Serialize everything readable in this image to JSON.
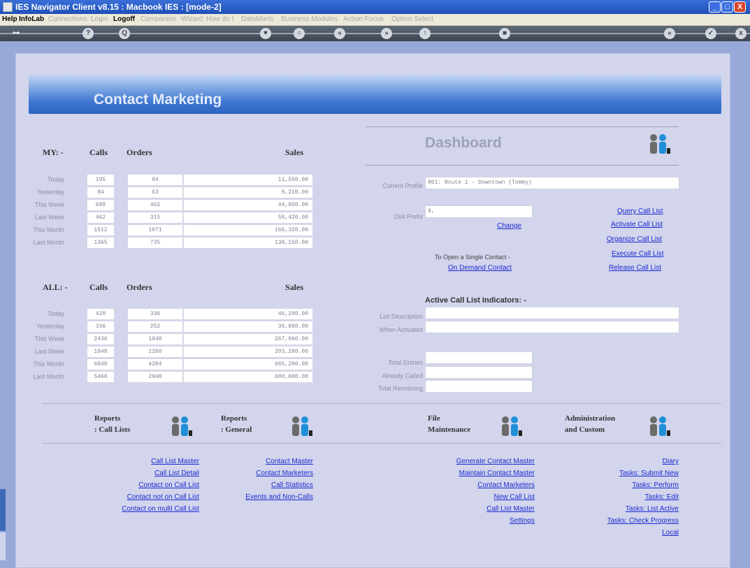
{
  "window": {
    "title": "IES Navigator Client v8.15 : Macbook IES :      [mode-2]",
    "min": "_",
    "max": "□",
    "close": "X"
  },
  "menu": {
    "items": [
      {
        "label": "Help",
        "enabled": true
      },
      {
        "label": "InfoLab",
        "enabled": true
      },
      {
        "label": "Connections",
        "enabled": false
      },
      {
        "label": "Login",
        "enabled": false
      },
      {
        "label": "Logoff",
        "enabled": true
      },
      {
        "label": "Companion",
        "enabled": false
      },
      {
        "label": "Wizard",
        "enabled": false
      },
      {
        "label": "How do I",
        "enabled": false
      },
      {
        "label": "DataMarts",
        "enabled": false
      },
      {
        "label": "Business Modules",
        "enabled": false
      },
      {
        "label": "Action Focus",
        "enabled": false
      },
      {
        "label": "Option Select",
        "enabled": false
      }
    ]
  },
  "navbar": {
    "buttons": [
      "?",
      "Q",
      "♥",
      "○",
      "«",
      "»",
      "↑",
      "■",
      "«",
      "✓",
      "x"
    ]
  },
  "page_title": "Contact Marketing",
  "my": {
    "heading": "MY: -",
    "col_calls": "Calls",
    "col_orders": "Orders",
    "col_sales": "Sales",
    "rows": [
      {
        "label": "Today",
        "calls": "195",
        "orders": "84",
        "sales": "11,550.00"
      },
      {
        "label": "Yesterday",
        "calls": "84",
        "orders": "63",
        "sales": "9,210.00"
      },
      {
        "label": "This Week",
        "calls": "689",
        "orders": "462",
        "sales": "44,950.00"
      },
      {
        "label": "Last Week",
        "calls": "462",
        "orders": "315",
        "sales": "58,420.00"
      },
      {
        "label": "This Month",
        "calls": "1512",
        "orders": "1071",
        "sales": "166,320.00"
      },
      {
        "label": "Last Month",
        "calls": "1365",
        "orders": "735",
        "sales": "138,150.00"
      }
    ]
  },
  "all": {
    "heading": "ALL: -",
    "col_calls": "Calls",
    "col_orders": "Orders",
    "col_sales": "Sales",
    "rows": [
      {
        "label": "Today",
        "calls": "420",
        "orders": "336",
        "sales": "46,200.00"
      },
      {
        "label": "Yesterday",
        "calls": "336",
        "orders": "252",
        "sales": "36,960.00"
      },
      {
        "label": "This Week",
        "calls": "2436",
        "orders": "1848",
        "sales": "267,960.00"
      },
      {
        "label": "Last Week",
        "calls": "1848",
        "orders": "1260",
        "sales": "203,280.00"
      },
      {
        "label": "This Month",
        "calls": "6048",
        "orders": "4284",
        "sales": "665,280.00"
      },
      {
        "label": "Last Month",
        "calls": "5460",
        "orders": "2940",
        "sales": "600,600.00"
      }
    ]
  },
  "dashboard": {
    "title": "Dashboard",
    "current_profile_label": "Current Profile",
    "current_profile_value": "001: Route 1 - Downtown (Tommy)",
    "dial_prefix_label": "Dial Prefix",
    "dial_prefix_value": "9,",
    "change_link": "Change",
    "single_contact_text": "To Open a Single Contact -",
    "on_demand_link": "On Demand Contact",
    "call_list_links": [
      "Query Call List",
      "Activate Call List",
      "Organize Call List",
      "Execute Call List",
      "Release Call List"
    ],
    "indicators_heading": "Active Call List Indicators: -",
    "list_description_label": "List Description",
    "when_activated_label": "When Activated",
    "total_entries_label": "Total Entries",
    "already_called_label": "Already Called",
    "total_remaining_label": "Total Remaining"
  },
  "groups": [
    {
      "title1": "Reports",
      "title2": ": Call Lists"
    },
    {
      "title1": "Reports",
      "title2": ": General"
    },
    {
      "title1": "File",
      "title2": "Maintenance"
    },
    {
      "title1": "Administration",
      "title2": "and Custom"
    }
  ],
  "links_call_lists": [
    "Call List Master",
    "Call List Detail",
    "Contact on Call List",
    "Contact not on Call List",
    "Contact on multi Call List"
  ],
  "links_general": [
    "Contact Master",
    "Contact Marketers",
    "Call Statistics",
    "Events and Non-Calls"
  ],
  "links_file": [
    "Generate Contact Master",
    "Maintain Contact Master",
    "Contact Marketers",
    "New Call List",
    "Call List Master",
    "Settings"
  ],
  "links_admin": [
    "Diary",
    "Tasks: Submit New",
    "Tasks: Perform",
    "Tasks: Edit",
    "Tasks: List Active",
    "Tasks: Check Progress",
    "Local"
  ],
  "colors": {
    "banner": "#3d76d2",
    "link": "#1a2ad0",
    "workspace": "#98a8d8",
    "panel": "#d2d5ec"
  }
}
